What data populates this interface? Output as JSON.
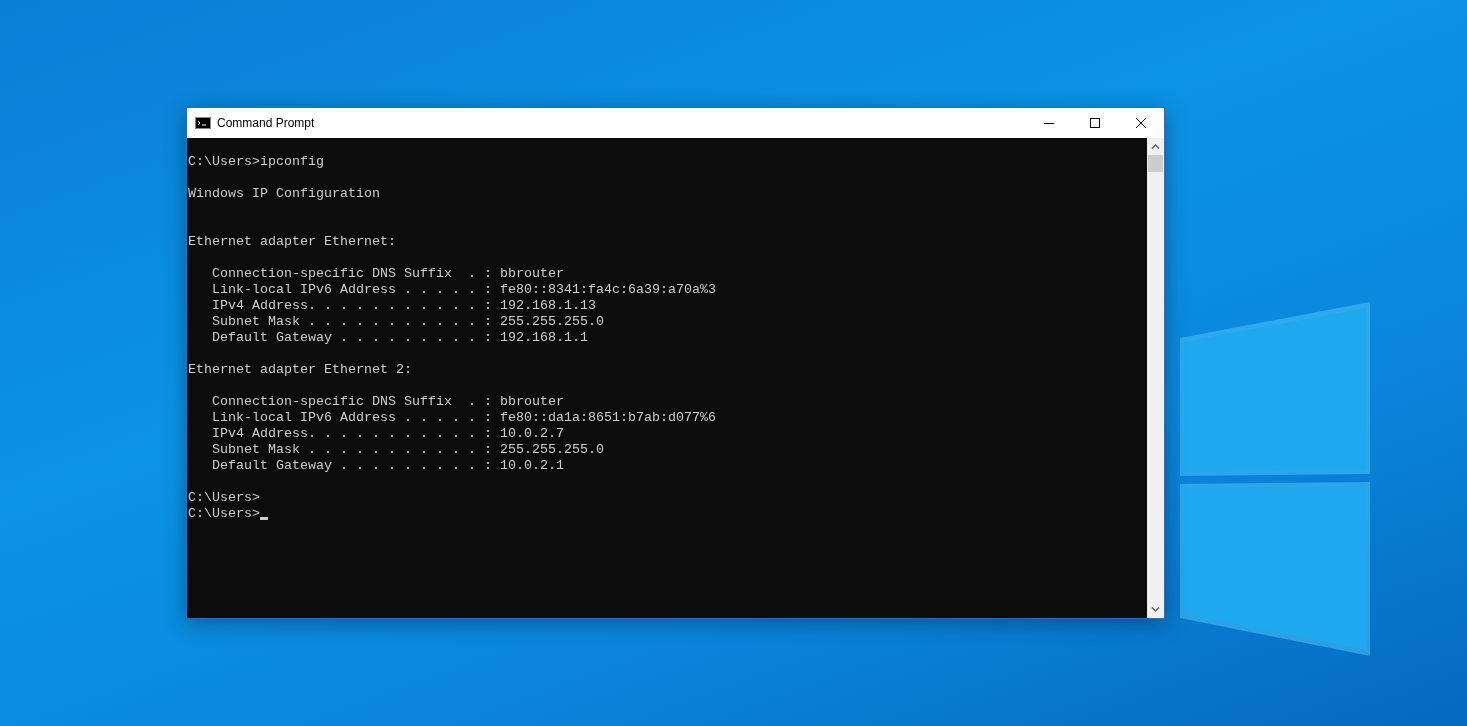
{
  "window": {
    "title": "Command Prompt"
  },
  "console": {
    "command_line": "C:\\Users>ipconfig",
    "header": "Windows IP Configuration",
    "adapters": [
      {
        "title": "Ethernet adapter Ethernet:",
        "fields": [
          "Connection-specific DNS Suffix  . : bbrouter",
          "Link-local IPv6 Address . . . . . : fe80::8341:fa4c:6a39:a70a%3",
          "IPv4 Address. . . . . . . . . . . : 192.168.1.13",
          "Subnet Mask . . . . . . . . . . . : 255.255.255.0",
          "Default Gateway . . . . . . . . . : 192.168.1.1"
        ]
      },
      {
        "title": "Ethernet adapter Ethernet 2:",
        "fields": [
          "Connection-specific DNS Suffix  . : bbrouter",
          "Link-local IPv6 Address . . . . . : fe80::da1a:8651:b7ab:d077%6",
          "IPv4 Address. . . . . . . . . . . : 10.0.2.7",
          "Subnet Mask . . . . . . . . . . . : 255.255.255.0",
          "Default Gateway . . . . . . . . . : 10.0.2.1"
        ]
      }
    ],
    "prompts": [
      {
        "text": "C:\\Users>",
        "cursor": false
      },
      {
        "text": "C:\\Users>",
        "cursor": true
      }
    ]
  }
}
